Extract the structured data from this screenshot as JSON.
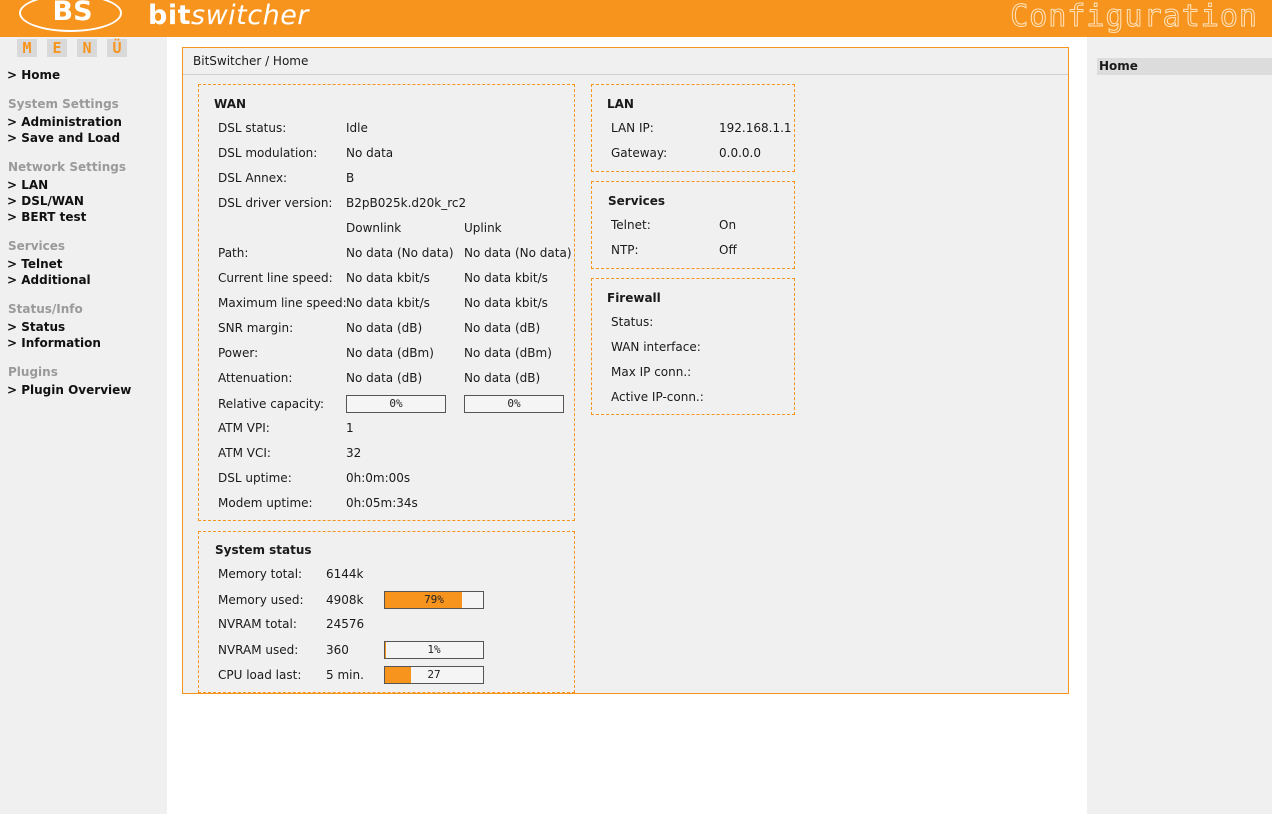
{
  "header": {
    "logo_text": "BS",
    "brand_part1": "bit",
    "brand_part2": "switcher",
    "title": "Configuration",
    "accent_color": "#f7941d"
  },
  "menu_letters": [
    "M",
    "E",
    "N",
    "Ü"
  ],
  "sidebar": {
    "home": "> Home",
    "system_settings": {
      "title": "System Settings",
      "items": [
        "> Administration",
        "> Save and Load"
      ]
    },
    "network_settings": {
      "title": "Network Settings",
      "items": [
        "> LAN",
        "> DSL/WAN",
        "> BERT test"
      ]
    },
    "services": {
      "title": "Services",
      "items": [
        "> Telnet",
        "> Additional"
      ]
    },
    "status_info": {
      "title": "Status/Info",
      "items": [
        "> Status",
        "> Information"
      ]
    },
    "plugins": {
      "title": "Plugins",
      "items": [
        "> Plugin Overview"
      ]
    }
  },
  "right_sidebar": {
    "home": "Home"
  },
  "breadcrumb": "BitSwitcher / Home",
  "wan": {
    "title": "WAN",
    "dsl_status_label": "DSL status:",
    "dsl_status": "Idle",
    "dsl_modulation_label": "DSL modulation:",
    "dsl_modulation": "No data",
    "dsl_annex_label": "DSL Annex:",
    "dsl_annex": "B",
    "dsl_driver_label": "DSL driver version:",
    "dsl_driver": "B2pB025k.d20k_rc2",
    "col_downlink": "Downlink",
    "col_uplink": "Uplink",
    "rows": [
      {
        "label": "Path:",
        "down": "No data (No data)",
        "up": "No data (No data)"
      },
      {
        "label": "Current line speed:",
        "down": "No data kbit/s",
        "up": "No data kbit/s"
      },
      {
        "label": "Maximum line speed:",
        "down": "No data kbit/s",
        "up": "No data kbit/s"
      },
      {
        "label": "SNR margin:",
        "down": "No data (dB)",
        "up": "No data (dB)"
      },
      {
        "label": "Power:",
        "down": "No data (dBm)",
        "up": "No data (dBm)"
      },
      {
        "label": "Attenuation:",
        "down": "No data (dB)",
        "up": "No data (dB)"
      }
    ],
    "relative_capacity_label": "Relative capacity:",
    "relative_capacity_down": "0%",
    "relative_capacity_down_fraction": 0,
    "relative_capacity_up": "0%",
    "relative_capacity_up_fraction": 0,
    "atm_vpi_label": "ATM VPI:",
    "atm_vpi": "1",
    "atm_vci_label": "ATM VCI:",
    "atm_vci": "32",
    "dsl_uptime_label": "DSL uptime:",
    "dsl_uptime": "0h:0m:00s",
    "modem_uptime_label": "Modem uptime:",
    "modem_uptime": "0h:05m:34s"
  },
  "system_status": {
    "title": "System status",
    "memory_total_label": "Memory total:",
    "memory_total": "6144k",
    "memory_used_label": "Memory used:",
    "memory_used": "4908k",
    "memory_used_bar": "79%",
    "memory_used_fraction": 0.79,
    "nvram_total_label": "NVRAM total:",
    "nvram_total": "24576",
    "nvram_used_label": "NVRAM used:",
    "nvram_used": "360",
    "nvram_used_bar": "1%",
    "nvram_used_fraction": 0.01,
    "cpu_load_label": "CPU load last:",
    "cpu_load_period": "5 min.",
    "cpu_load_bar": "27",
    "cpu_load_fraction": 0.27
  },
  "lan": {
    "title": "LAN",
    "lan_ip_label": "LAN IP:",
    "lan_ip": "192.168.1.1",
    "gateway_label": "Gateway:",
    "gateway": "0.0.0.0"
  },
  "services_box": {
    "title": "Services",
    "telnet_label": "Telnet:",
    "telnet": "On",
    "ntp_label": "NTP:",
    "ntp": "Off"
  },
  "firewall": {
    "title": "Firewall",
    "status_label": "Status:",
    "wan_interface_label": "WAN interface:",
    "max_ip_label": "Max IP conn.:",
    "active_ip_label": "Active IP-conn.:"
  }
}
